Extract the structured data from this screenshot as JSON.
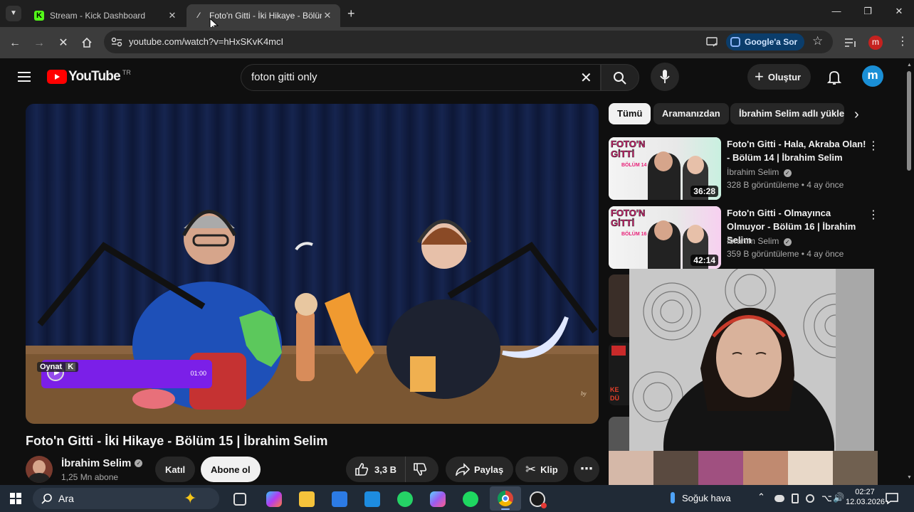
{
  "browser": {
    "tabs": [
      {
        "title": "Stream - Kick Dashboard",
        "favicon": "kick-icon"
      },
      {
        "title": "Foto'n Gitti - İki Hikaye - Bölüm",
        "favicon": "loading-icon"
      }
    ],
    "url": "youtube.com/watch?v=hHxSKvK4mcI",
    "ask_google": "Google'a Sor",
    "profile_initial": "m"
  },
  "youtube": {
    "logo_text": "YouTube",
    "logo_region": "TR",
    "search_query": "foton gitti only",
    "create_label": "Oluştur",
    "avatar_initial": "m"
  },
  "video": {
    "overlay_label": "Oynat",
    "overlay_key": "K",
    "overlay_time": "01:00",
    "title": "Foto'n Gitti - İki Hikaye - Bölüm 15 | İbrahim Selim",
    "channel": "İbrahim Selim",
    "subscribers": "1,25 Mn abone",
    "join_label": "Katıl",
    "subscribe_label": "Abone ol",
    "likes": "3,3 B",
    "share_label": "Paylaş",
    "clip_label": "Klip"
  },
  "chips": [
    "Tümü",
    "Aramanızdan",
    "İbrahim Selim adlı yükleyiciden"
  ],
  "recommendations": [
    {
      "title": "Foto'n Gitti - Hala, Akraba Olan! - Bölüm 14 | İbrahim Selim",
      "channel": "İbrahim Selim",
      "meta": "328 B görüntüleme • 4 ay önce",
      "duration": "36:28",
      "thumb_text": "FOTO'N GİTTİ",
      "thumb_sub": "BÖLÜM 14"
    },
    {
      "title": "Foto'n Gitti - Olmayınca Olmuyor - Bölüm 16 | İbrahim Selim",
      "channel": "İbrahim Selim",
      "meta": "359 B görüntüleme • 4 ay önce",
      "duration": "42:14",
      "thumb_text": "FOTO'N GİTTİ",
      "thumb_sub": "BÖLÜM 16"
    }
  ],
  "partial_thumb_text": "KE DÜ",
  "taskbar": {
    "search_label": "Ara",
    "weather": "Soğuk hava",
    "time": "02:27",
    "date": "12.03.2026"
  },
  "colors": {
    "youtube_red": "#ff0000",
    "accent_blue": "#3ea6ff",
    "profile_red": "#c5221f",
    "avatar_blue": "#1a8fd6",
    "overlay_purple": "#7b1fe8"
  }
}
